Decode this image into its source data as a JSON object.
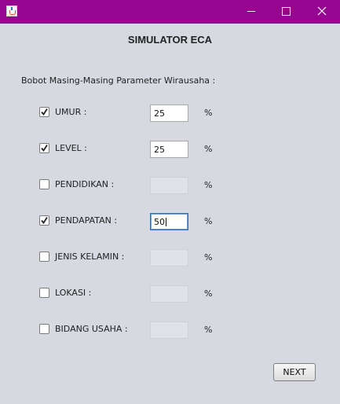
{
  "window": {
    "icon": "java-cup-icon",
    "controls": [
      "minimize-icon",
      "maximize-icon",
      "close-icon"
    ],
    "titlebar_color": "#95058f"
  },
  "heading": "SIMULATOR ECA",
  "prompt": "Bobot Masing-Masing Parameter Wirausaha :",
  "parameters": [
    {
      "label": "UMUR :",
      "checked": true,
      "value": "25",
      "enabled": true,
      "unit": "%"
    },
    {
      "label": "LEVEL :",
      "checked": true,
      "value": "25",
      "enabled": true,
      "unit": "%"
    },
    {
      "label": "PENDIDIKAN :",
      "checked": false,
      "value": "",
      "enabled": false,
      "unit": "%"
    },
    {
      "label": "PENDAPATAN :",
      "checked": true,
      "value": "50",
      "enabled": true,
      "focused": true,
      "unit": "%"
    },
    {
      "label": "JENIS KELAMIN :",
      "checked": false,
      "value": "",
      "enabled": false,
      "unit": "%"
    },
    {
      "label": "LOKASI :",
      "checked": false,
      "value": "",
      "enabled": false,
      "unit": "%"
    },
    {
      "label": "BIDANG USAHA :",
      "checked": false,
      "value": "",
      "enabled": false,
      "unit": "%"
    }
  ],
  "next_button": "NEXT"
}
